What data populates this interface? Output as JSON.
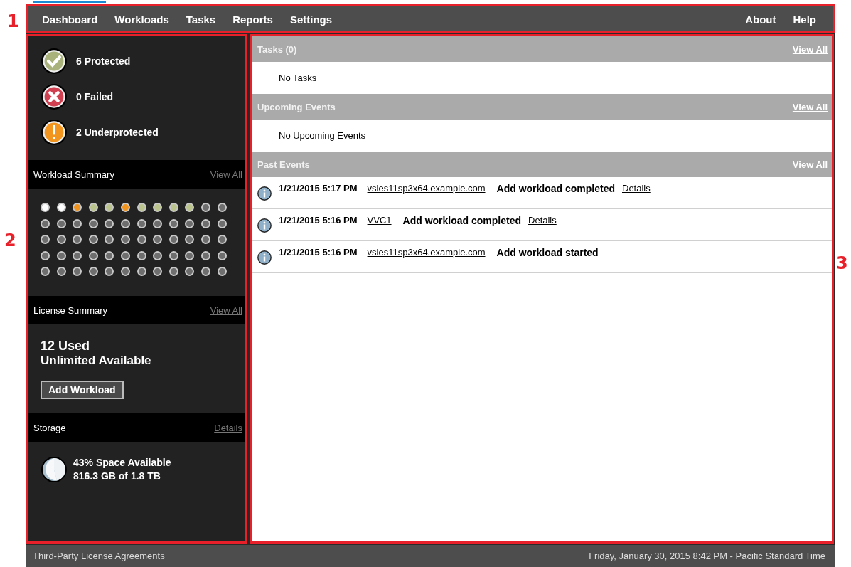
{
  "callouts": [
    "1",
    "2",
    "3"
  ],
  "nav": {
    "left": [
      {
        "label": "Dashboard",
        "selected": true
      },
      {
        "label": "Workloads",
        "selected": false
      },
      {
        "label": "Tasks",
        "selected": false
      },
      {
        "label": "Reports",
        "selected": false
      },
      {
        "label": "Settings",
        "selected": false
      }
    ],
    "right": [
      "About",
      "Help"
    ]
  },
  "sidebar": {
    "statuses": [
      {
        "kind": "ok",
        "label": "6 Protected"
      },
      {
        "kind": "failed",
        "label": "0 Failed"
      },
      {
        "kind": "warning",
        "label": "2 Underprotected"
      }
    ],
    "workload_summary": {
      "title": "Workload Summary",
      "link": "View All",
      "dots": [
        {
          "color": "#ffffff"
        },
        {
          "color": "#ffffff"
        },
        {
          "color": "#f0941e"
        },
        {
          "color": "#bcc48e"
        },
        {
          "color": "#bcc48e"
        },
        {
          "color": "#f0941e"
        },
        {
          "color": "#bcc48e"
        },
        {
          "color": "#bcc48e"
        },
        {
          "color": "#bcc48e"
        },
        {
          "color": "#bcc48e"
        },
        {
          "color": "#6e6e6e"
        },
        {
          "color": "#6e6e6e"
        },
        {
          "color": "#6e6e6e"
        },
        {
          "color": "#6e6e6e"
        },
        {
          "color": "#6e6e6e"
        },
        {
          "color": "#6e6e6e"
        },
        {
          "color": "#6e6e6e"
        },
        {
          "color": "#6e6e6e"
        },
        {
          "color": "#6e6e6e"
        },
        {
          "color": "#6e6e6e"
        },
        {
          "color": "#6e6e6e"
        },
        {
          "color": "#6e6e6e"
        },
        {
          "color": "#6e6e6e"
        },
        {
          "color": "#6e6e6e"
        },
        {
          "color": "#6e6e6e"
        },
        {
          "color": "#6e6e6e"
        },
        {
          "color": "#6e6e6e"
        },
        {
          "color": "#6e6e6e"
        },
        {
          "color": "#6e6e6e"
        },
        {
          "color": "#6e6e6e"
        },
        {
          "color": "#6e6e6e"
        },
        {
          "color": "#6e6e6e"
        },
        {
          "color": "#6e6e6e"
        },
        {
          "color": "#6e6e6e"
        },
        {
          "color": "#6e6e6e"
        },
        {
          "color": "#6e6e6e"
        },
        {
          "color": "#6e6e6e"
        },
        {
          "color": "#6e6e6e"
        },
        {
          "color": "#6e6e6e"
        },
        {
          "color": "#6e6e6e"
        },
        {
          "color": "#6e6e6e"
        },
        {
          "color": "#6e6e6e"
        },
        {
          "color": "#6e6e6e"
        },
        {
          "color": "#6e6e6e"
        },
        {
          "color": "#6e6e6e"
        },
        {
          "color": "#6e6e6e"
        },
        {
          "color": "#6e6e6e"
        },
        {
          "color": "#6e6e6e"
        },
        {
          "color": "#6e6e6e"
        },
        {
          "color": "#6e6e6e"
        },
        {
          "color": "#6e6e6e"
        },
        {
          "color": "#6e6e6e"
        },
        {
          "color": "#6e6e6e"
        },
        {
          "color": "#6e6e6e"
        },
        {
          "color": "#6e6e6e"
        },
        {
          "color": "#6e6e6e"
        },
        {
          "color": "#6e6e6e"
        },
        {
          "color": "#6e6e6e"
        },
        {
          "color": "#6e6e6e"
        },
        {
          "color": "#6e6e6e"
        }
      ]
    },
    "license_summary": {
      "title": "License Summary",
      "link": "View All",
      "used": "12 Used",
      "available": "Unlimited Available",
      "button": "Add Workload"
    },
    "storage": {
      "title": "Storage",
      "link": "Details",
      "available": "43% Space Available",
      "capacity": "816.3 GB of 1.8 TB"
    }
  },
  "main": {
    "tasks": {
      "title": "Tasks (0)",
      "link": "View All",
      "empty": "No Tasks"
    },
    "upcoming_events": {
      "title": "Upcoming Events",
      "link": "View All",
      "empty": "No Upcoming Events"
    },
    "past_events": {
      "title": "Past Events",
      "link": "View All",
      "events": [
        {
          "time": "1/21/2015 5:17 PM",
          "source": "vsles11sp3x64.example.com",
          "message": "Add workload completed",
          "details": "Details"
        },
        {
          "time": "1/21/2015 5:16 PM",
          "source": "VVC1",
          "message": "Add workload completed",
          "details": "Details"
        },
        {
          "time": "1/21/2015 5:16 PM",
          "source": "vsles11sp3x64.example.com",
          "message": "Add workload started"
        }
      ]
    }
  },
  "status_bar": {
    "left": "Third-Party License Agreements",
    "right": "Friday, January 30, 2015 8:42 PM - Pacific Standard Time"
  }
}
